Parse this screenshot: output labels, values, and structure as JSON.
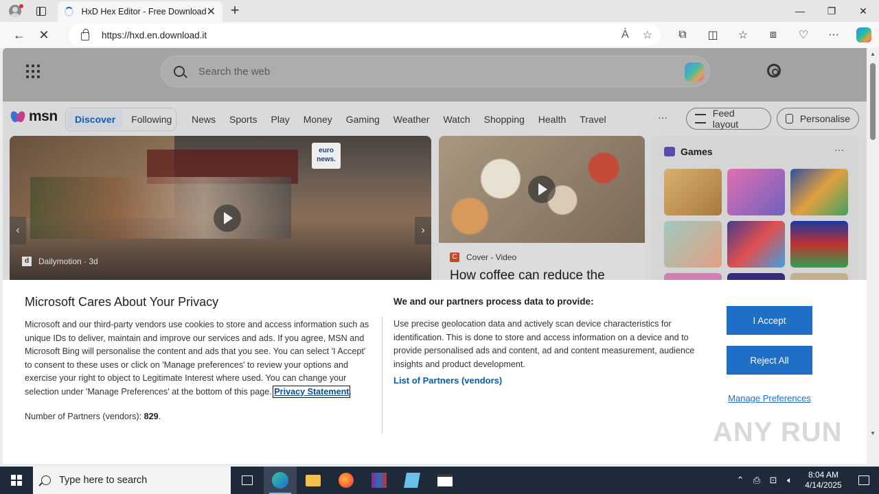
{
  "browser": {
    "tab_title": "HxD Hex Editor - Free Download",
    "url": "https://hxd.en.download.it",
    "window_controls": {
      "minimize": "—",
      "restore": "❐",
      "close": "✕"
    }
  },
  "msn": {
    "search_placeholder": "Search the web",
    "logo_text": "msn",
    "segment": {
      "active": "Discover",
      "inactive": "Following"
    },
    "nav_items": [
      "News",
      "Sports",
      "Play",
      "Money",
      "Gaming",
      "Weather",
      "Watch",
      "Shopping",
      "Health",
      "Travel"
    ],
    "more": "···",
    "feed_layout": "Feed layout",
    "personalise": "Personalise",
    "card_main": {
      "source": "Dailymotion · 3d",
      "badge_text": "euro news."
    },
    "card_mid": {
      "source": "Cover - Video",
      "headline": "How coffee can reduce the"
    },
    "games": {
      "title": "Games",
      "more": "···"
    }
  },
  "privacy": {
    "title": "Microsoft Cares About Your Privacy",
    "body": "Microsoft and our third-party vendors use cookies to store and access information such as unique IDs to deliver, maintain and improve our services and ads. If you agree, MSN and Microsoft Bing will personalise the content and ads that you see. You can select 'I Accept' to consent to these uses or click on 'Manage preferences' to review your options and exercise your right to object to Legitimate Interest where used.  You can change your selection under 'Manage Preferences' at the bottom of this page.",
    "privacy_link": "Privacy Statement",
    "partners_label": "Number of Partners (vendors):",
    "partners_count": "829",
    "right_heading": "We and our partners process data to provide:",
    "right_body": "Use precise geolocation data and actively scan device characteristics for identification. This is done to store and access information on a device and to provide personalised ads and content, ad and content measurement, audience insights and product development.",
    "list_partners": "List of Partners (vendors)",
    "accept": "I Accept",
    "reject": "Reject All",
    "manage": "Manage Preferences"
  },
  "watermark": "ANY RUN",
  "taskbar": {
    "search_placeholder": "Type here to search",
    "time": "8:04 AM",
    "date": "4/14/2025"
  }
}
